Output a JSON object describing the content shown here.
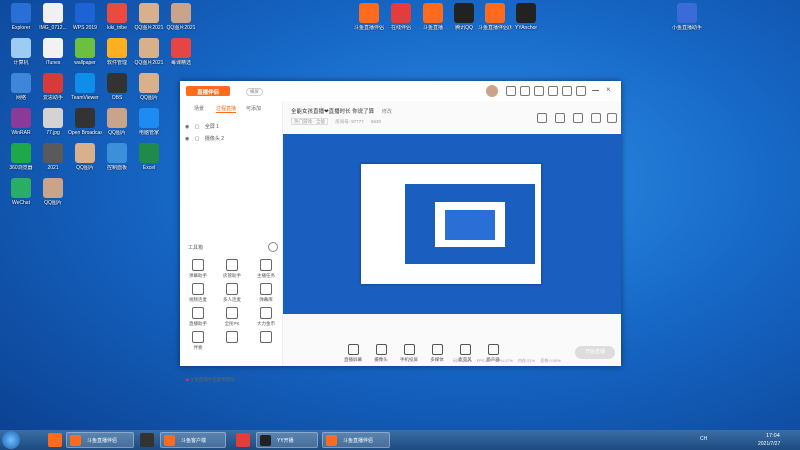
{
  "desktop": {
    "icons": [
      {
        "label": "Explorer",
        "color": "#2a6fd6"
      },
      {
        "label": "IMG_0712...",
        "color": "#f0f0f0"
      },
      {
        "label": "WPS 2019",
        "color": "#1e63d6"
      },
      {
        "label": "kiki_tribe",
        "color": "#e94b3c"
      },
      {
        "label": "QQ图片2021",
        "color": "#d8b08c"
      },
      {
        "label": "QQ图片2021",
        "color": "#c9a38a"
      },
      {
        "label": "计算机",
        "color": "#9ecbf0"
      },
      {
        "label": "iTunes",
        "color": "#f2f2f2"
      },
      {
        "label": "wallpaper",
        "color": "#6cbf3f"
      },
      {
        "label": "软件管理",
        "color": "#ffb020"
      },
      {
        "label": "QQ图片2021",
        "color": "#d8b08c"
      },
      {
        "label": "每课精选",
        "color": "#e64545"
      },
      {
        "label": "网络",
        "color": "#3d86d8"
      },
      {
        "label": "爱思助手",
        "color": "#d83a3a"
      },
      {
        "label": "TeamViewer",
        "color": "#0e8ee9"
      },
      {
        "label": "OBS",
        "color": "#333"
      },
      {
        "label": "QQ图片",
        "color": "#d8b08c"
      },
      {
        "label": "回收站",
        "color": "#cde"
      },
      {
        "label": "WinRAR",
        "color": "#8b3a9a"
      },
      {
        "label": "77.jpg",
        "color": "#d3d3d3"
      },
      {
        "label": "Open Broadcast",
        "color": "#333"
      },
      {
        "label": "QQ图片",
        "color": "#c9a38a"
      },
      {
        "label": "电脑管家",
        "color": "#1e8bf0"
      },
      {
        "label": "2021-08-10",
        "color": "#e9a23b"
      },
      {
        "label": "360浏览器",
        "color": "#1ea84a"
      },
      {
        "label": "2021",
        "color": "#5a5a5a"
      },
      {
        "label": "QQ图片",
        "color": "#d8b08c"
      },
      {
        "label": "控制面板",
        "color": "#3c8fd9"
      },
      {
        "label": "Excel",
        "color": "#1f8a4a"
      },
      {
        "label": "QQ浏览器",
        "color": "#2f7fe0"
      },
      {
        "label": "WeChat",
        "color": "#2aae67"
      },
      {
        "label": "QQ图片",
        "color": "#c9a38a"
      }
    ],
    "top_icons": [
      {
        "label": "斗鱼直播伴侣",
        "color": "#ff6b1a"
      },
      {
        "label": "在线伴侣",
        "color": "#e43b3b"
      },
      {
        "label": "斗鱼直播",
        "color": "#ff6b1a"
      },
      {
        "label": "腾讯QQ",
        "color": "#222"
      },
      {
        "label": "斗鱼直播伴侣(绿)",
        "color": "#ff6b1a"
      },
      {
        "label": "YYAnchor",
        "color": "#222"
      },
      {
        "label": "小鱼直播助手",
        "color": "#3a6bd6"
      }
    ]
  },
  "app": {
    "logo": "直播伴侣",
    "mode": "横屏",
    "title_line": "全能女孩直播❤直播时长 你说了算",
    "edit_label": "修改",
    "meta": [
      "热门游戏 - 全能",
      "房间号: 97777",
      "6630"
    ],
    "left_tabs": [
      "场景",
      "过程直播",
      "可添加"
    ],
    "active_tab": "过程直播",
    "scenes": [
      "全屏 1",
      "摄像头 2"
    ],
    "toolbox_title": "工具箱",
    "tools": [
      {
        "label": "弹幕助手"
      },
      {
        "label": "房管助手"
      },
      {
        "label": "主播任务"
      },
      {
        "label": "视频连麦"
      },
      {
        "label": "多人连麦"
      },
      {
        "label": "弹幕库"
      },
      {
        "label": "直播助手"
      },
      {
        "label": "全民PK"
      },
      {
        "label": "大力金币"
      },
      {
        "label": "伴奏",
        "badge": ""
      },
      {
        "label": ""
      },
      {
        "label": ""
      }
    ],
    "footer_note": "斗鱼直播伴侣使用帮助",
    "controls": [
      "直播屏幕",
      "摄像头",
      "手机投屏",
      "多媒体",
      "麦克风",
      "扬声器"
    ],
    "start_label": "开始直播",
    "status": [
      "码率 0kb/s",
      "FPS:60",
      "CPU:17%",
      "内存:21%",
      "丢帧:0.00%"
    ]
  },
  "taskbar": {
    "buttons": [
      {
        "label": "斗鱼直播伴侣",
        "color": "#ff6b1a"
      },
      {
        "label": "斗鱼客户端",
        "color": "#ff6b1a"
      },
      {
        "label": "YY开播",
        "color": "#222"
      },
      {
        "label": "斗鱼直播伴侣",
        "color": "#ff6b1a"
      }
    ],
    "time": "17:04",
    "date": "2021/7/27",
    "lang": "CH"
  }
}
